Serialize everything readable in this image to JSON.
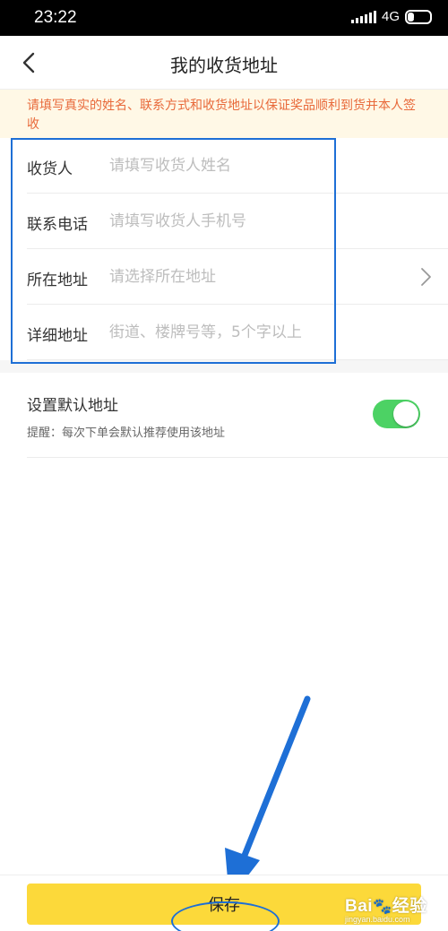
{
  "status_bar": {
    "time": "23:22",
    "network": "4G",
    "battery": "25",
    "battery_level": 0.25
  },
  "nav": {
    "title": "我的收货地址",
    "back_icon": "chevron-left-icon"
  },
  "notice": {
    "text": "请填写真实的姓名、联系方式和收货地址以保证奖品顺利到货并本人签收"
  },
  "form": {
    "fields": [
      {
        "label": "收货人",
        "placeholder": "请填写收货人姓名",
        "value": ""
      },
      {
        "label": "联系电话",
        "placeholder": "请填写收货人手机号",
        "value": ""
      },
      {
        "label": "所在地址",
        "placeholder": "请选择所在地址",
        "value": ""
      },
      {
        "label": "详细地址",
        "placeholder": "街道、楼牌号等，5个字以上",
        "value": ""
      }
    ]
  },
  "default_address": {
    "title": "设置默认地址",
    "hint": "提醒：每次下单会默认推荐使用该地址",
    "enabled": true
  },
  "footer": {
    "save_label": "保存"
  },
  "watermark": {
    "brand": "Bai",
    "brand_suffix": "经验",
    "url": "jingyan.baidu.com"
  },
  "colors": {
    "accent_yellow": "#fcd93a",
    "toggle_green": "#4cd264",
    "annotation_blue": "#1e6fd6",
    "notice_text": "#e8693a",
    "notice_bg": "#fff8e6"
  }
}
